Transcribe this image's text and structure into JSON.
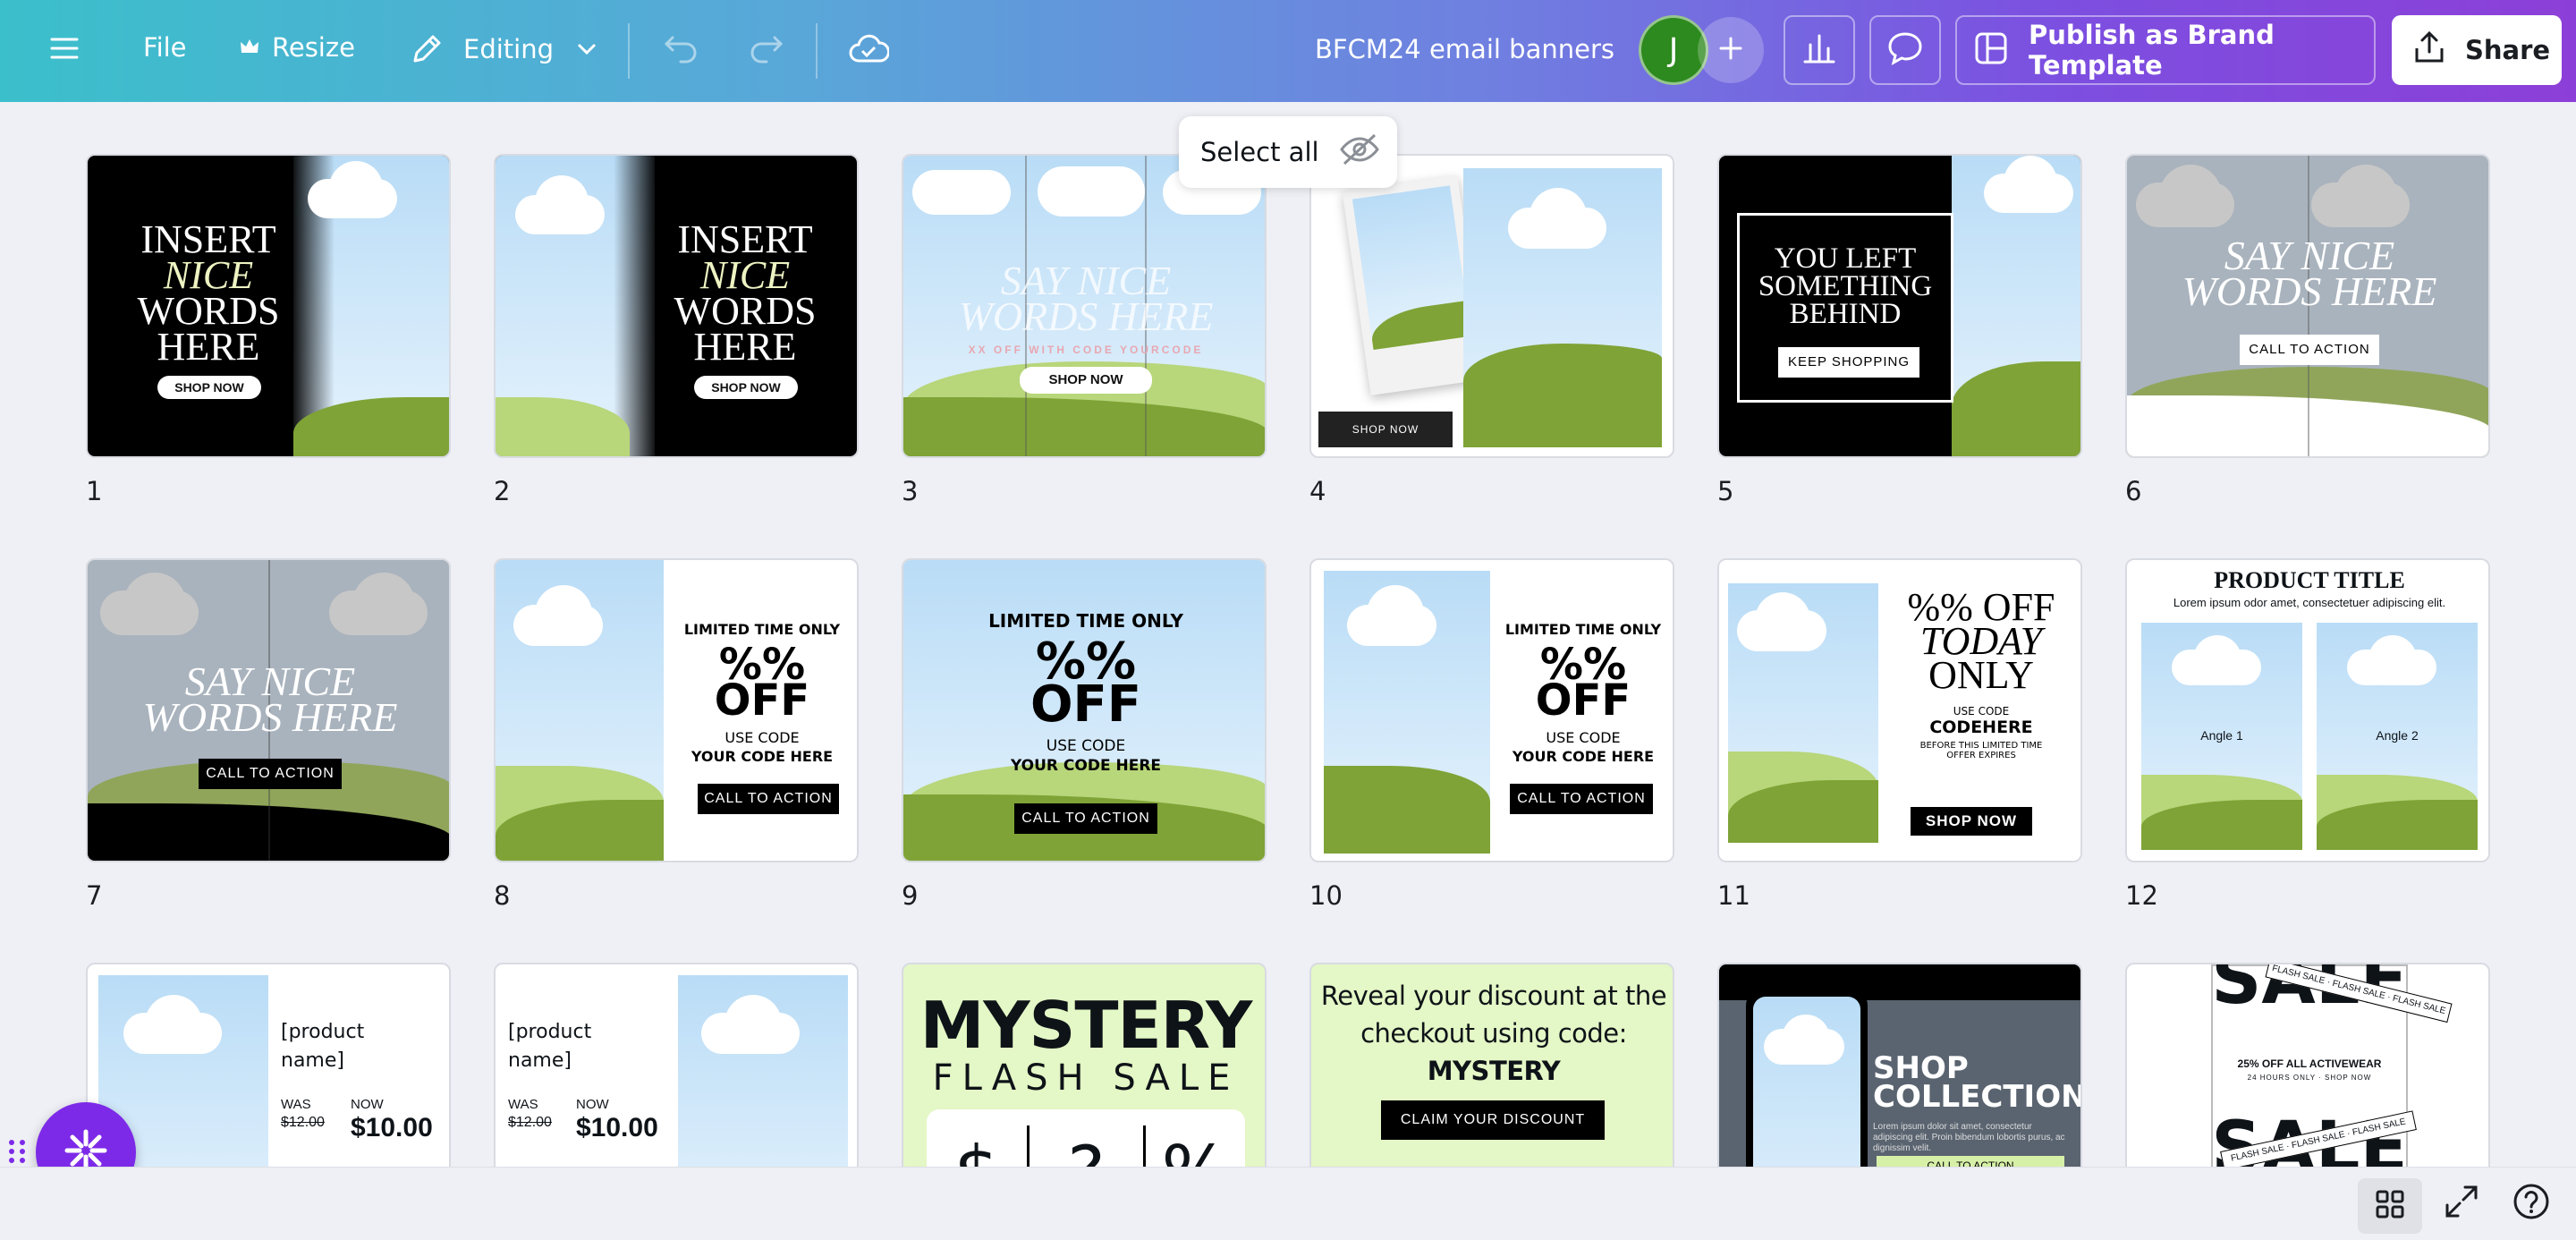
{
  "topbar": {
    "file_label": "File",
    "resize_label": "Resize",
    "editing_label": "Editing",
    "doc_title": "BFCM24 email banners",
    "avatar_letter": "J",
    "publish_label": "Publish as Brand Template",
    "share_label": "Share"
  },
  "select_all_label": "Select all",
  "pages": [
    {
      "num": "1",
      "lines": [
        "INSERT",
        "NICE",
        "WORDS",
        "HERE"
      ],
      "btn": "SHOP NOW"
    },
    {
      "num": "2",
      "lines": [
        "INSERT",
        "NICE",
        "WORDS",
        "HERE"
      ],
      "btn": "SHOP NOW"
    },
    {
      "num": "3",
      "lines": [
        "SAY NICE",
        "WORDS HERE"
      ],
      "sub": "XX OFF WITH CODE YOURCODE",
      "btn": "SHOP NOW"
    },
    {
      "num": "4",
      "btn": "SHOP NOW"
    },
    {
      "num": "5",
      "lines": [
        "YOU LEFT",
        "SOMETHING",
        "BEHIND"
      ],
      "btn": "KEEP SHOPPING"
    },
    {
      "num": "6",
      "lines": [
        "SAY NICE",
        "WORDS HERE"
      ],
      "btn": "CALL TO ACTION"
    },
    {
      "num": "7",
      "lines": [
        "SAY NICE",
        "WORDS HERE"
      ],
      "btn": "CALL TO ACTION"
    },
    {
      "num": "8",
      "top": "LIMITED TIME ONLY",
      "big1": "%%",
      "big2": "OFF",
      "use": "USE CODE",
      "code": "YOUR CODE HERE",
      "btn": "CALL TO ACTION"
    },
    {
      "num": "9",
      "top": "LIMITED TIME ONLY",
      "big1": "%%",
      "big2": "OFF",
      "use": "USE CODE",
      "code": "YOUR CODE HERE",
      "btn": "CALL TO ACTION"
    },
    {
      "num": "10",
      "top": "LIMITED TIME ONLY",
      "big1": "%%",
      "big2": "OFF",
      "use": "USE CODE",
      "code": "YOUR CODE HERE",
      "btn": "CALL TO ACTION"
    },
    {
      "num": "11",
      "l1": "%% OFF",
      "l2": "TODAY",
      "l3": "ONLY",
      "use": "USE CODE",
      "code": "CODEHERE",
      "before1": "BEFORE THIS LIMITED TIME",
      "before2": "OFFER EXPIRES",
      "btn": "SHOP NOW"
    },
    {
      "num": "12",
      "title": "PRODUCT TITLE",
      "sub": "Lorem ipsum odor amet, consectetuer adipiscing elit.",
      "a1": "Angle 1",
      "a2": "Angle 2"
    },
    {
      "name1": "[product",
      "name2": "name]",
      "was": "WAS",
      "was_price": "$12.00",
      "now": "NOW",
      "now_price": "$10.00"
    },
    {
      "name1": "[product",
      "name2": "name]",
      "was": "WAS",
      "was_price": "$12.00",
      "now": "NOW",
      "now_price": "$10.00"
    },
    {
      "l1": "MYSTERY",
      "l2": "FLASH SALE",
      "c1": "$",
      "c2": "?",
      "c3": "%"
    },
    {
      "l1": "Reveal your discount at the",
      "l2": "checkout using code:",
      "code": "MYSTERY",
      "btn": "CLAIM YOUR DISCOUNT"
    },
    {
      "l1": "SHOP",
      "l2": "COLLECTION",
      "body": "Lorem ipsum dolor sit amet, consectetur adipiscing elit. Proin bibendum lobortis purus, ac dignissim velit.",
      "btn": "CALL TO ACTION"
    },
    {
      "big": "SALE",
      "tape": "FLASH SALE · FLASH SALE · FLASH SALE",
      "l1": "25% OFF ALL ACTIVEWEAR",
      "l2": "24 HOURS ONLY · SHOP NOW"
    }
  ],
  "colors": {
    "accent": "#7d2ae8",
    "avatar_bg": "#2d8a1e",
    "grass_light": "#b8d67a",
    "grass_dark": "#7fa336",
    "float_btn": "#7d2ae8",
    "lime": "#e4f7c6"
  }
}
